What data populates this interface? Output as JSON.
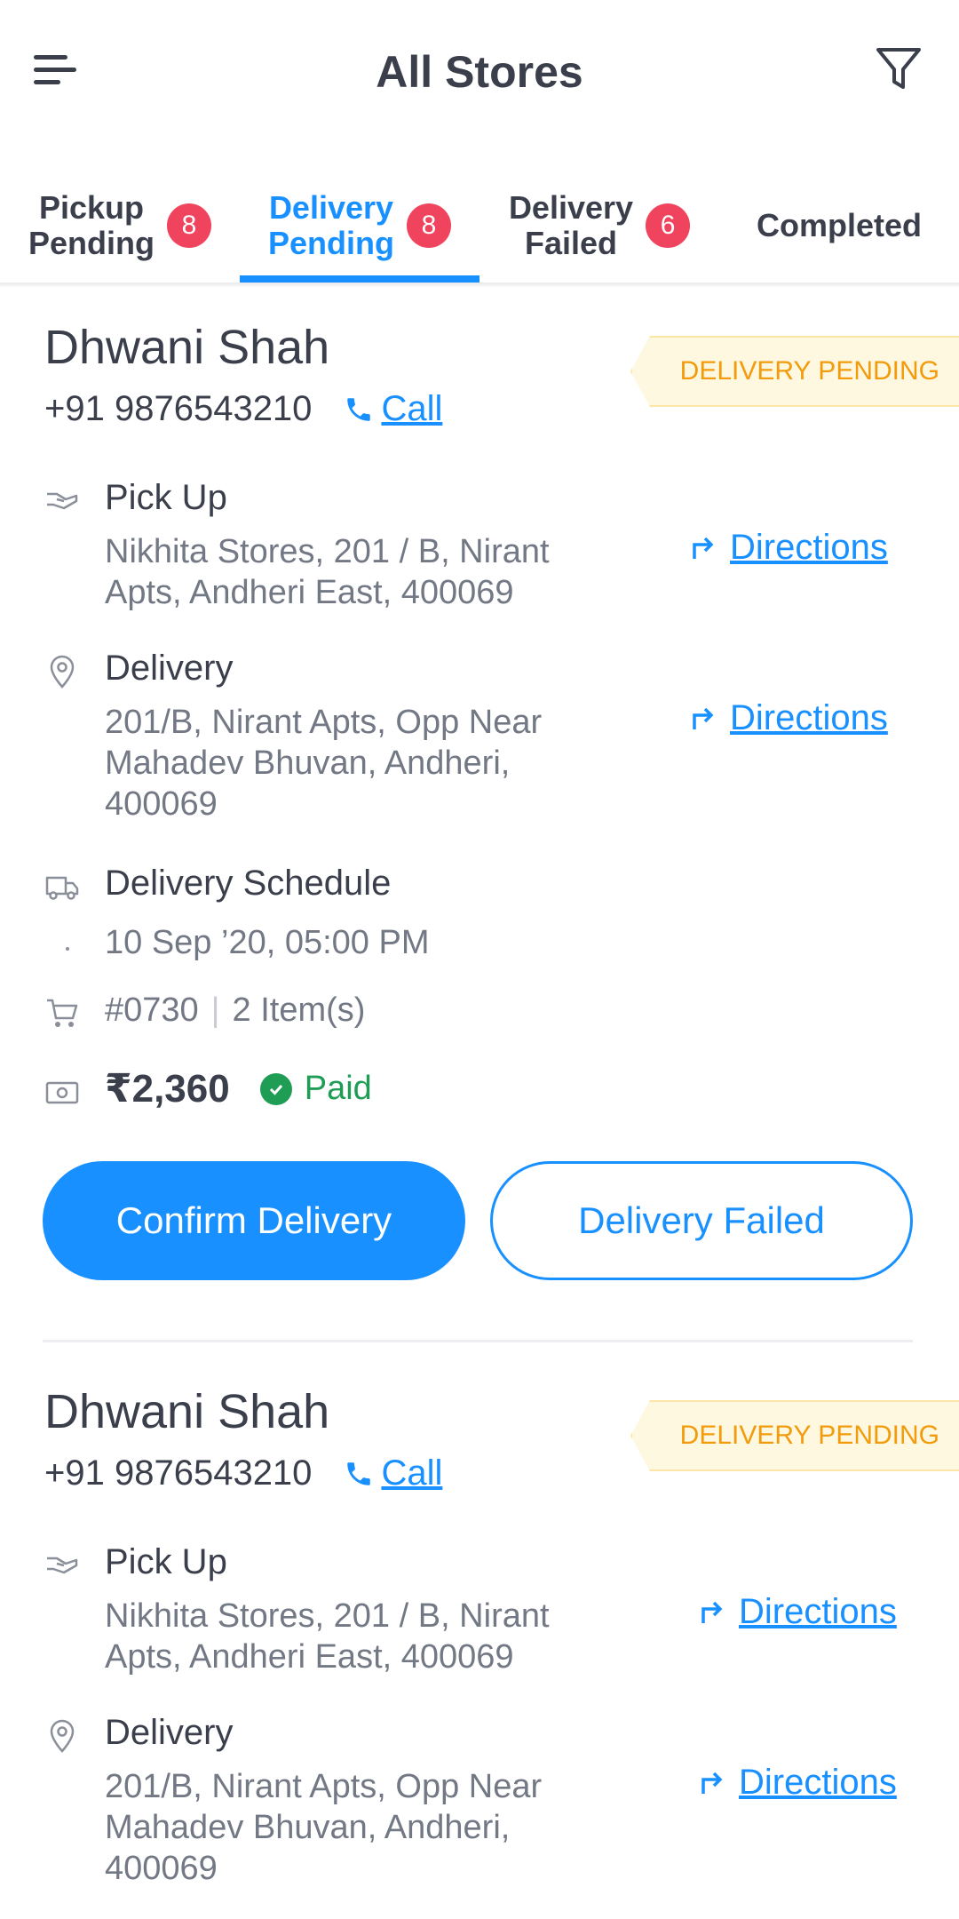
{
  "header": {
    "title": "All Stores",
    "menu_icon": "hamburger-menu-icon",
    "filter_icon": "filter-funnel-icon"
  },
  "tabs": [
    {
      "line1": "Pickup",
      "line2": "Pending",
      "badge": "8",
      "active": false
    },
    {
      "line1": "Delivery",
      "line2": "Pending",
      "badge": "8",
      "active": true
    },
    {
      "line1": "Delivery",
      "line2": "Failed",
      "badge": "6",
      "active": false
    },
    {
      "line1": "Completed",
      "line2": "",
      "badge": "",
      "active": false
    }
  ],
  "colors": {
    "accent": "#1890ff",
    "badge": "#f0445e",
    "pending_tag_bg": "#fff8e1",
    "pending_tag_text": "#f29b0c",
    "paid": "#1f9d55"
  },
  "orders": [
    {
      "customer_name": "Dhwani Shah",
      "status": "DELIVERY PENDING",
      "phone": "+91 9876543210",
      "call_label": "Call",
      "pickup": {
        "title": "Pick Up",
        "line1": "Nikhita Stores, 201 / B, Nirant",
        "line2": "Apts, Andheri East, 400069",
        "directions": "Directions"
      },
      "delivery": {
        "title": "Delivery",
        "line1": "201/B, Nirant Apts, Opp Near",
        "line2": "Mahadev Bhuvan, Andheri,",
        "line3": "400069",
        "directions": "Directions"
      },
      "schedule": {
        "title": "Delivery Schedule",
        "value": "10 Sep ’20, 05:00 PM"
      },
      "order_id": "#0730",
      "items": "2 Item(s)",
      "amount": "₹2,360",
      "payment_status": "Paid",
      "confirm_label": "Confirm Delivery",
      "failed_label": "Delivery Failed"
    },
    {
      "customer_name": "Dhwani Shah",
      "status": "DELIVERY PENDING",
      "phone": "+91 9876543210",
      "call_label": "Call",
      "pickup": {
        "title": "Pick Up",
        "line1": "Nikhita Stores, 201 / B, Nirant",
        "line2": "Apts, Andheri East, 400069",
        "directions": "Directions"
      },
      "delivery": {
        "title": "Delivery",
        "line1": "201/B, Nirant Apts, Opp Near",
        "line2": "Mahadev Bhuvan, Andheri,",
        "line3": "400069",
        "directions": "Directions"
      }
    }
  ]
}
